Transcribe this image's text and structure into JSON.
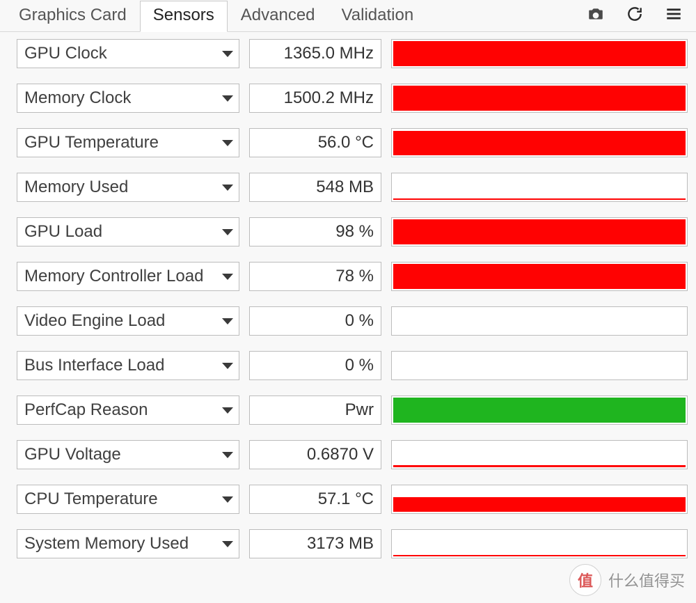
{
  "tabs": [
    {
      "label": "Graphics Card",
      "active": false
    },
    {
      "label": "Sensors",
      "active": true
    },
    {
      "label": "Advanced",
      "active": false
    },
    {
      "label": "Validation",
      "active": false
    }
  ],
  "icons": {
    "camera": "camera-icon",
    "refresh": "refresh-icon",
    "menu": "menu-icon"
  },
  "sensors": [
    {
      "name": "GPU Clock",
      "value": "1365.0 MHz",
      "fill_pct": 100,
      "color": "#ff0202"
    },
    {
      "name": "Memory Clock",
      "value": "1500.2 MHz",
      "fill_pct": 100,
      "color": "#ff0202"
    },
    {
      "name": "GPU Temperature",
      "value": "56.0 °C",
      "fill_pct": 92,
      "color": "#ff0202"
    },
    {
      "name": "Memory Used",
      "value": "548 MB",
      "fill_pct": 6,
      "color": "#ff0202"
    },
    {
      "name": "GPU Load",
      "value": "98 %",
      "fill_pct": 98,
      "color": "#ff0202"
    },
    {
      "name": "Memory Controller Load",
      "value": "78 %",
      "fill_pct": 100,
      "color": "#ff0202"
    },
    {
      "name": "Video Engine Load",
      "value": "0 %",
      "fill_pct": 0,
      "color": "#ff0202"
    },
    {
      "name": "Bus Interface Load",
      "value": "0 %",
      "fill_pct": 0,
      "color": "#ff0202"
    },
    {
      "name": "PerfCap Reason",
      "value": "Pwr",
      "fill_pct": 100,
      "color": "#1fb51f"
    },
    {
      "name": "GPU Voltage",
      "value": "0.6870 V",
      "fill_pct": 8,
      "color": "#ff0202"
    },
    {
      "name": "CPU Temperature",
      "value": "57.1 °C",
      "fill_pct": 55,
      "color": "#ff0202"
    },
    {
      "name": "System Memory Used",
      "value": "3173 MB",
      "fill_pct": 6,
      "color": "#ff0202"
    }
  ],
  "watermark": {
    "badge": "值",
    "text": "什么值得买"
  }
}
